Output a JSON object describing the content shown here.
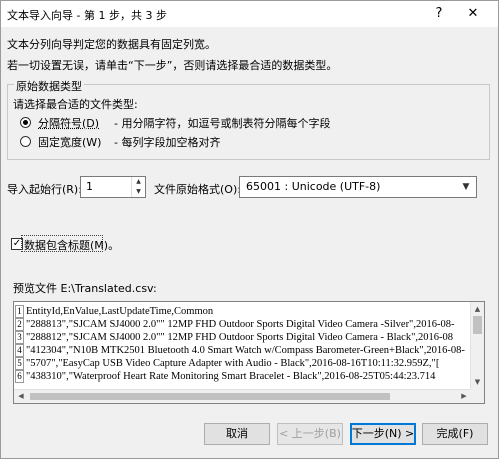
{
  "window": {
    "title": "文本导入向导 - 第 1 步，共 3 步",
    "help_glyph": "?",
    "close_glyph": "✕"
  },
  "intro": {
    "line1": "文本分列向导判定您的数据具有固定列宽。",
    "line2": "若一切设置无误，请单击“下一步”，否则请选择最合适的数据类型。"
  },
  "original_type": {
    "group_title": "原始数据类型",
    "prompt": "请选择最合适的文件类型:",
    "options": [
      {
        "label": "分隔符号(D)",
        "description": "- 用分隔字符，如逗号或制表符分隔每个字段",
        "selected": true
      },
      {
        "label": "固定宽度(W)",
        "description": "- 每列字段加空格对齐",
        "selected": false
      }
    ]
  },
  "import_start": {
    "label": "导入起始行(R):",
    "value": "1"
  },
  "file_origin": {
    "label": "文件原始格式(O):",
    "value": "65001 : Unicode (UTF-8)"
  },
  "header_checkbox": {
    "label": "数据包含标题(M)。",
    "checked": true,
    "check_glyph": "✓"
  },
  "preview": {
    "label": "预览文件 E:\\Translated.csv:",
    "rows": [
      {
        "num": "1",
        "text": "EntityId,EnValue,LastUpdateTime,Common"
      },
      {
        "num": "2",
        "text": "\"288813\",\"SJCAM SJ4000 2.0\"\" 12MP FHD Outdoor Sports Digital Video Camera -Silver\",2016-08-"
      },
      {
        "num": "3",
        "text": "\"288812\",\"SJCAM SJ4000 2.0\"\" 12MP FHD Outdoor Sports Digital Video Camera - Black\",2016-08"
      },
      {
        "num": "4",
        "text": "\"412304\",\"N10B MTK2501 Bluetooth 4.0 Smart Watch w/Compass Barometer-Green+Black\",2016-08-"
      },
      {
        "num": "5",
        "text": "\"5707\",\"EasyCap USB Video Capture Adapter with Audio - Black\",2016-08-16T10:11:32.959Z,\"["
      },
      {
        "num": "6",
        "text": "\"438310\",\"Waterproof Heart Rate Monitoring Smart Bracelet - Black\",2016-08-25T05:44:23.714"
      }
    ]
  },
  "buttons": {
    "cancel": "取消",
    "back": "< 上一步(B)",
    "next": "下一步(N) >",
    "finish": "完成(F)"
  },
  "icons": {
    "spin_up": "▲",
    "spin_down": "▼",
    "combo_arrow": "▼",
    "scroll_up": "▲",
    "scroll_down": "▼",
    "scroll_left": "◀",
    "scroll_right": "▶"
  }
}
